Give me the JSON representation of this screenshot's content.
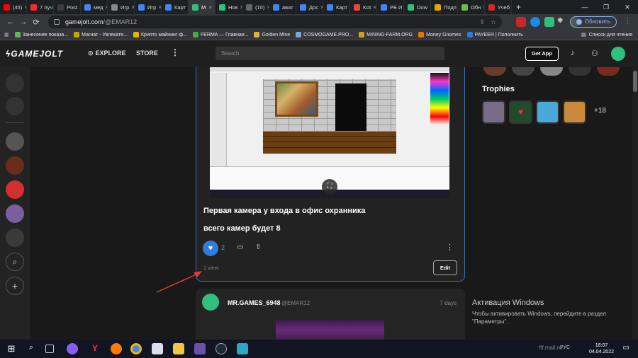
{
  "browser": {
    "tabs": [
      {
        "label": "(45)",
        "color": "#ff0000"
      },
      {
        "label": "7 луч",
        "color": "#ff2a2a"
      },
      {
        "label": "Post",
        "color": "#3c3c3c"
      },
      {
        "label": "мед",
        "color": "#4285f4"
      },
      {
        "label": "Игр",
        "color": "#888888"
      },
      {
        "label": "Игр",
        "color": "#4285f4"
      },
      {
        "label": "Карт",
        "color": "#4285f4"
      },
      {
        "label": "М",
        "color": "#2ec07c",
        "active": true
      },
      {
        "label": "Нов",
        "color": "#2ec07c"
      },
      {
        "label": "(10)",
        "color": "#666666"
      },
      {
        "label": "ават",
        "color": "#4285f4"
      },
      {
        "label": "Дос",
        "color": "#4285f4"
      },
      {
        "label": "Карт",
        "color": "#4285f4"
      },
      {
        "label": "Kot",
        "color": "#e8453c"
      },
      {
        "label": "РБ И",
        "color": "#4285f4"
      },
      {
        "label": "Dow",
        "color": "#2ec07c"
      },
      {
        "label": "Подп",
        "color": "#e0a800"
      },
      {
        "label": "Обн",
        "color": "#6bbd45"
      },
      {
        "label": "Учеб",
        "color": "#d62828"
      }
    ],
    "new_tab": "+",
    "url_host": "gamejolt.com",
    "url_path": "/@EMAR12",
    "update_label": "Обновить",
    "reading_list": "Список для чтения",
    "bookmarks": [
      {
        "label": "Занесение показа...",
        "color": "#5cb85c"
      },
      {
        "label": "Магнат - Увлекате...",
        "color": "#c8a400"
      },
      {
        "label": "Крипто майнинг ф...",
        "color": "#f0b000"
      },
      {
        "label": "FERMA — Главная...",
        "color": "#44aa44"
      },
      {
        "label": "Golden Mine",
        "color": "#e0b040"
      },
      {
        "label": "COSMOGAME.PRO...",
        "color": "#7aa5d8"
      },
      {
        "label": "MINING-FARM.ORG",
        "color": "#d4a017"
      },
      {
        "label": "Money Gnomes",
        "color": "#e07b00"
      },
      {
        "label": "PAYEER | Пополнить",
        "color": "#2a7ae2"
      }
    ]
  },
  "gamejolt": {
    "logo": "GAMEJOLT",
    "nav_explore": "EXPLORE",
    "nav_store": "STORE",
    "search_placeholder": "Search",
    "get_app": "Get App"
  },
  "post": {
    "title": "Первая камера у входа в офис охранника",
    "subtitle": "всего камер будет 8",
    "likes": "2",
    "views": "1 view",
    "edit": "Edit"
  },
  "post2": {
    "author": "MR.GAMES_6948",
    "handle": "@EMAR12",
    "time": "7 days"
  },
  "sidebar_right": {
    "trophies_heading": "Trophies",
    "trophy_more": "+18"
  },
  "windows": {
    "activate_title": "Активация Windows",
    "activate_text": "Чтобы активировать Windows, перейдите в раздел \"Параметры\".",
    "lang": "РУС",
    "time": "16:07",
    "date": "04.04.2022",
    "watermark": "ftf.mail.ru"
  },
  "colors": {
    "accent": "#2f7ddb",
    "post_border": "#3b6fb0",
    "gj_green": "#2ec07c"
  }
}
